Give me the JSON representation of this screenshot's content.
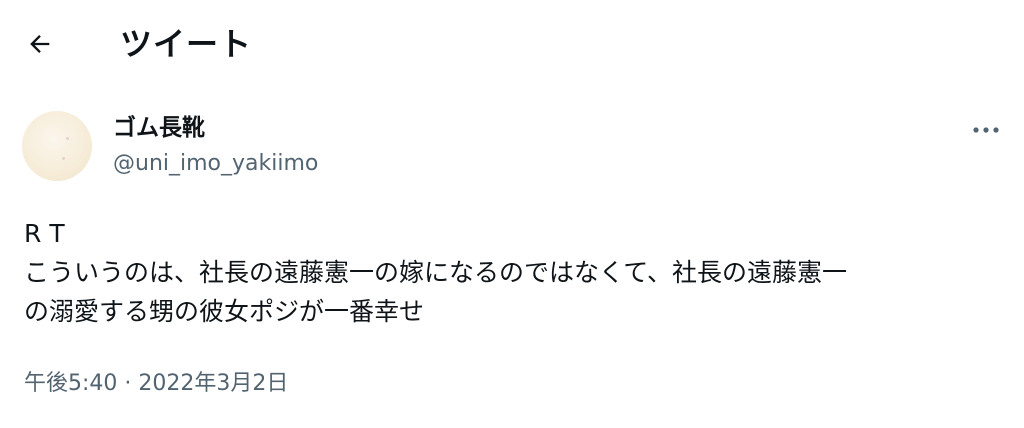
{
  "header": {
    "title": "ツイート",
    "back_icon": "arrow-left-icon"
  },
  "tweet": {
    "author": {
      "display_name": "ゴム長靴",
      "handle": "@uni_imo_yakiimo"
    },
    "more_icon": "more-horizontal-icon",
    "text": "R T\nこういうのは、社長の遠藤憲一の嫁になるのではなくて、社長の遠藤憲一\nの溺愛する甥の彼女ポジが一番幸せ",
    "timestamp": "午後5:40 · 2022年3月2日"
  },
  "colors": {
    "text_primary": "#0f1419",
    "text_secondary": "#536471",
    "background": "#ffffff"
  }
}
